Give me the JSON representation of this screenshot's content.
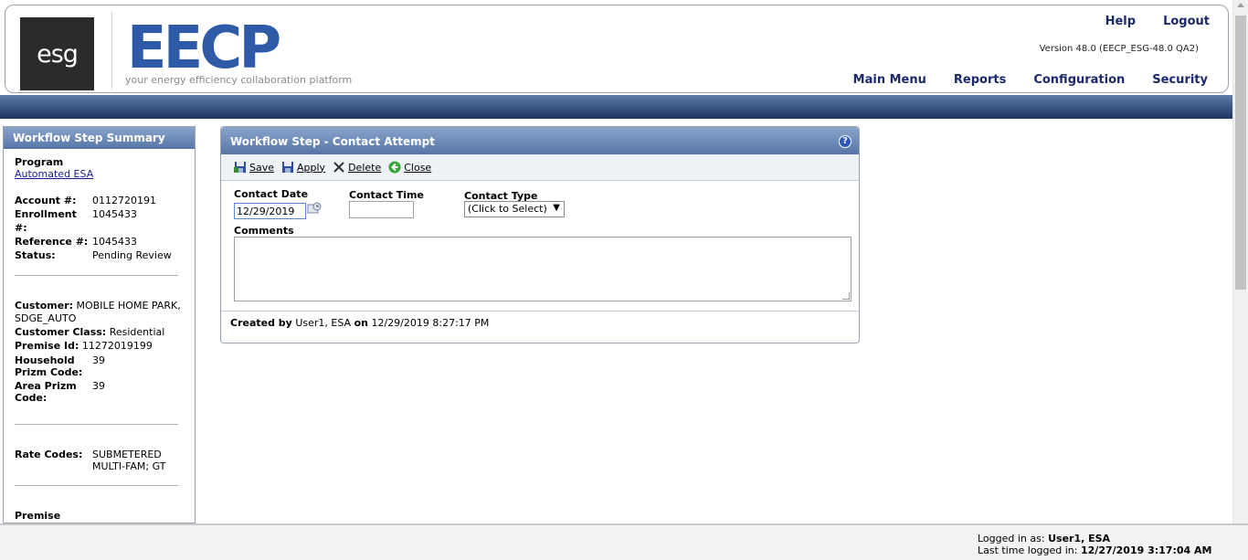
{
  "header": {
    "esg_logo_text": "esg",
    "eecp_logo_text": "EECP",
    "tagline": "your energy efficiency collaboration platform",
    "help": "Help",
    "logout": "Logout",
    "version": "Version 48.0 (EECP_ESG-48.0 QA2)",
    "nav": [
      "Main Menu",
      "Reports",
      "Configuration",
      "Security"
    ]
  },
  "summary": {
    "title": "Workflow Step Summary",
    "program_label": "Program",
    "program_value": "Automated ESA",
    "account_label": "Account #:",
    "account_value": "0112720191",
    "enrollment_label": "Enrollment #:",
    "enrollment_value": "1045433",
    "reference_label": "Reference #:",
    "reference_value": "1045433",
    "status_label": "Status:",
    "status_value": "Pending Review",
    "customer_label": "Customer:",
    "customer_value": "MOBILE HOME PARK, SDGE_AUTO",
    "customer_class_label": "Customer Class:",
    "customer_class_value": "Residential",
    "premise_id_label": "Premise Id:",
    "premise_id_value": "11272019199",
    "household_prizm_label": "Household Prizm Code:",
    "household_prizm_value": "39",
    "area_prizm_label": "Area Prizm Code:",
    "area_prizm_value": "39",
    "rate_codes_label": "Rate Codes:",
    "rate_codes_value": "SUBMETERED MULTI-FAM; GT",
    "premise_accounts_label": "Premise Acccount(s):"
  },
  "panel": {
    "title": "Workflow Step - Contact Attempt",
    "toolbar": {
      "save": "Save",
      "apply": "Apply",
      "delete": "Delete",
      "close": "Close"
    },
    "contact_date_label": "Contact Date",
    "contact_date_value": "12/29/2019",
    "contact_time_label": "Contact Time",
    "contact_time_value": "",
    "contact_type_label": "Contact Type",
    "contact_type_value": "(Click to Select)",
    "comments_label": "Comments",
    "comments_value": "",
    "created_by_label": "Created by",
    "created_by_value": "User1, ESA",
    "created_on_label": "on",
    "created_on_value": "12/29/2019 8:27:17 PM"
  },
  "footer": {
    "logged_in_label": "Logged in as:",
    "logged_in_value": "User1, ESA",
    "last_login_label": "Last time logged in:",
    "last_login_value": "12/27/2019 3:17:04 AM"
  },
  "colors": {
    "header_band": "#1e3560",
    "panel_header": "#5675a7",
    "nav_text": "#1a2a6a",
    "logo_blue": "#2e5aa8"
  }
}
